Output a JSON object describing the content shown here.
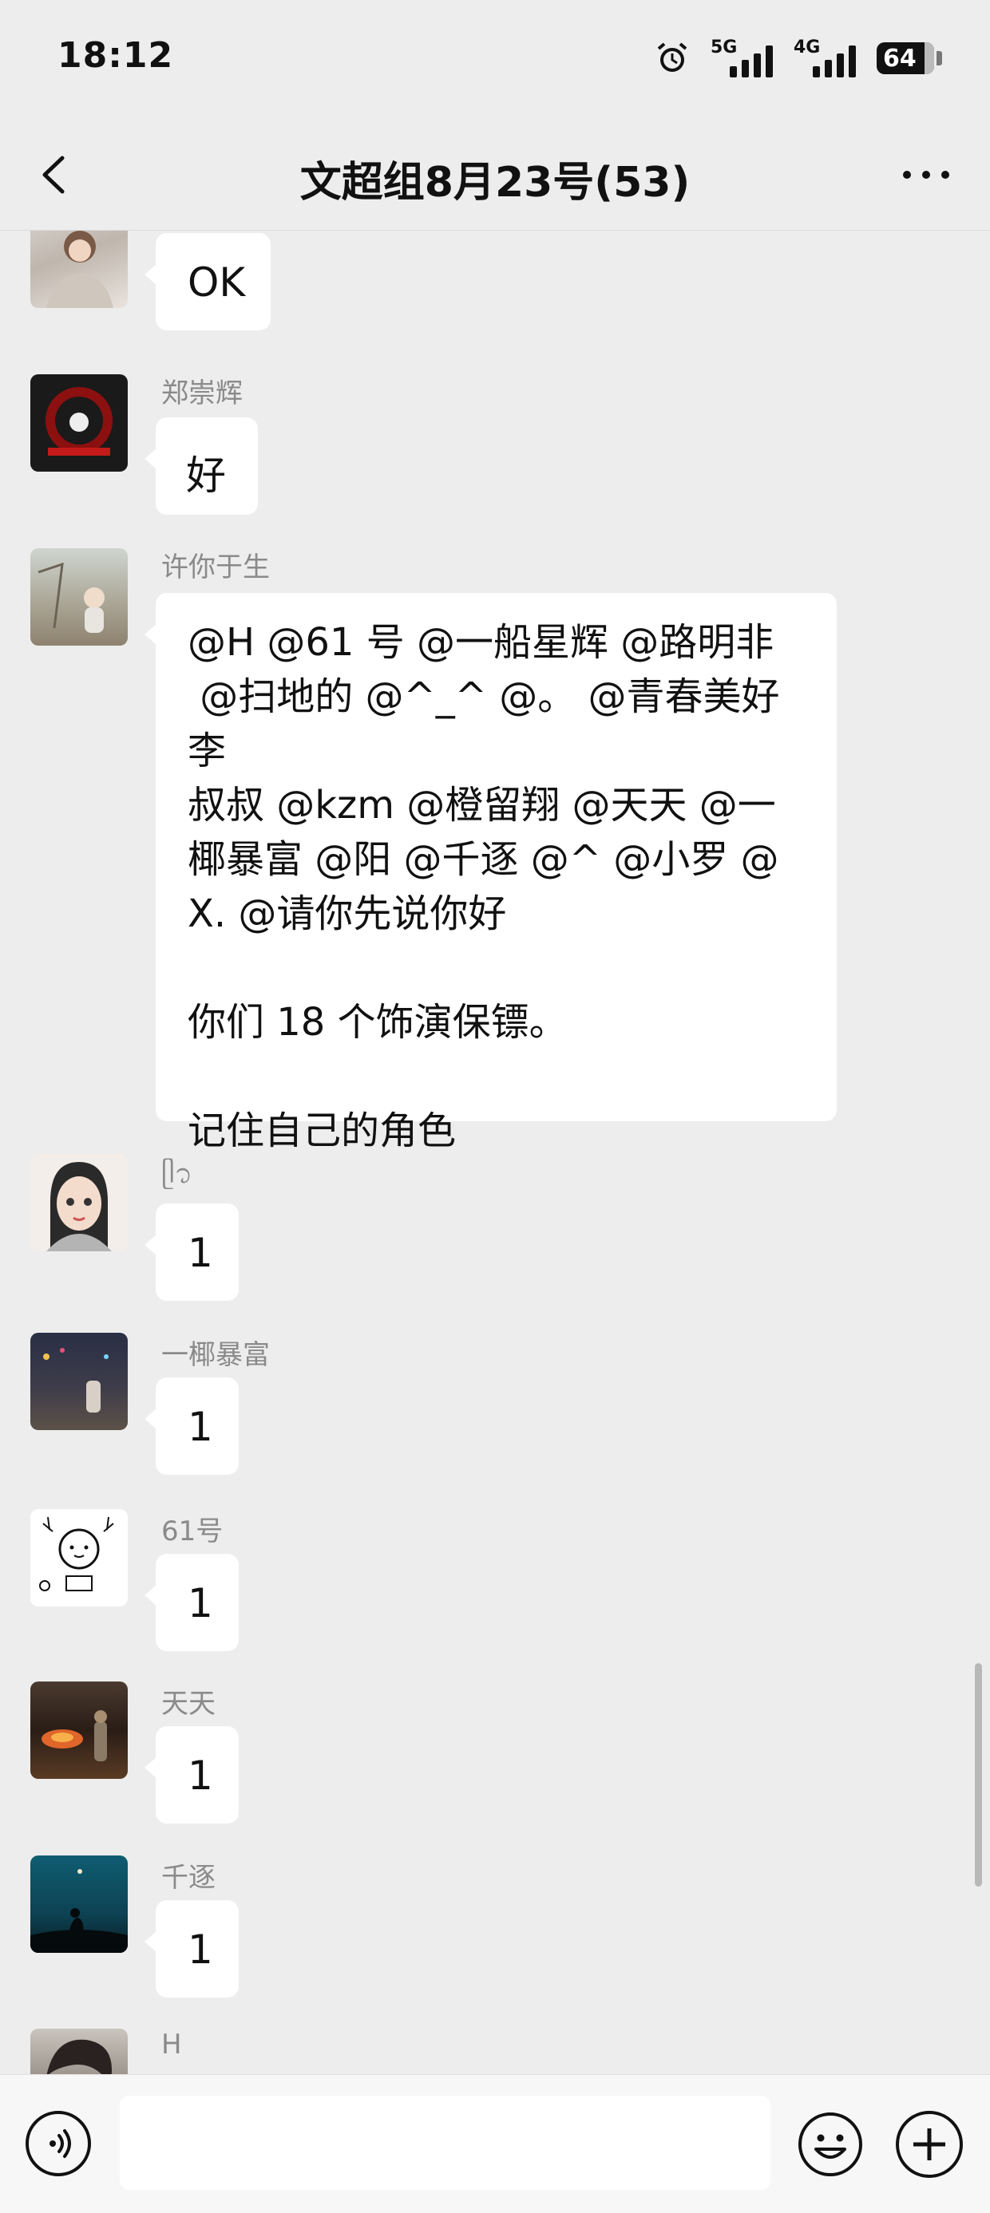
{
  "status_bar": {
    "time": "18:12",
    "network_1": "5G",
    "network_2": "4G",
    "battery": "64"
  },
  "header": {
    "title": "文超组8月23号(53)",
    "back_icon": "chevron-left-icon",
    "more_icon": "more-dots-icon"
  },
  "messages": [
    {
      "sender": "",
      "text": "OK"
    },
    {
      "sender": "郑崇辉",
      "text": "好"
    },
    {
      "sender": "许你于生",
      "text": "@H @61 号 @一船星辉 @路明非\n @扫地的 @^_^ @。 @青春美好李\n叔叔 @kzm @橙留翔 @天天 @一\n椰暴富 @阳 @千逐 @^ @小罗 @\nX. @请你先说你好\n\n你们 18 个饰演保镖。\n\n记住自己的角色"
    },
    {
      "sender": "ᥫ᭡",
      "text": "1"
    },
    {
      "sender": "一椰暴富",
      "text": "1"
    },
    {
      "sender": "61号",
      "text": "1"
    },
    {
      "sender": "天天",
      "text": "1"
    },
    {
      "sender": "千逐",
      "text": "1"
    },
    {
      "sender": "H",
      "text": ""
    }
  ],
  "input_bar": {
    "voice_icon": "voice-icon",
    "emoji_icon": "emoji-icon",
    "plus_icon": "plus-icon"
  }
}
